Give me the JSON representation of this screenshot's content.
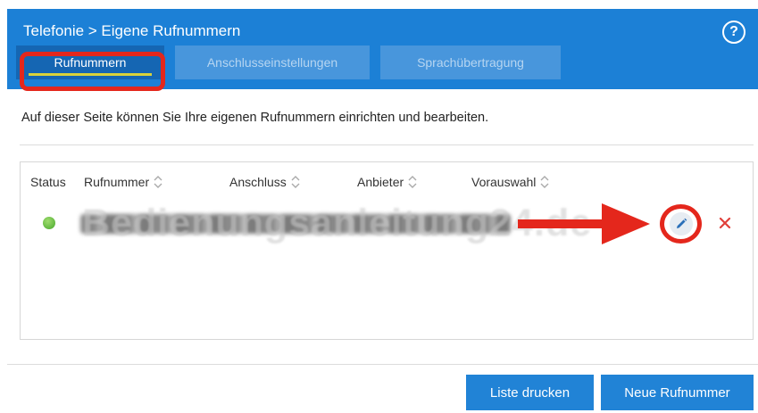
{
  "header": {
    "breadcrumb": "Telefonie > Eigene Rufnummern",
    "help_icon": "question-circle-icon",
    "help_glyph": "?"
  },
  "tabs": [
    {
      "label": "Rufnummern",
      "active": true
    },
    {
      "label": "Anschlusseinstellungen",
      "active": false
    },
    {
      "label": "Sprachübertragung",
      "active": false
    }
  ],
  "intro_text": "Auf dieser Seite können Sie Ihre eigenen Rufnummern einrichten und bearbeiten.",
  "table": {
    "columns": [
      "Status",
      "Rufnummer",
      "Anschluss",
      "Anbieter",
      "Vorauswahl"
    ],
    "rows": [
      {
        "status": "active-green",
        "rufnummer": "[blurred]",
        "edit_icon": "pencil-icon",
        "delete_icon": "close-icon"
      }
    ]
  },
  "watermark": "Bedienungsanleitung24.de",
  "buttons": {
    "print": "Liste drucken",
    "new": "Neue Rufnummer"
  },
  "colors": {
    "header_bg": "#1c80d6",
    "tab_active_bg": "#1566b3",
    "tab_inactive_bg": "#4896dc",
    "annotation_red": "#e4271c",
    "button_bg": "#2183d6",
    "status_green": "#47a82b"
  }
}
